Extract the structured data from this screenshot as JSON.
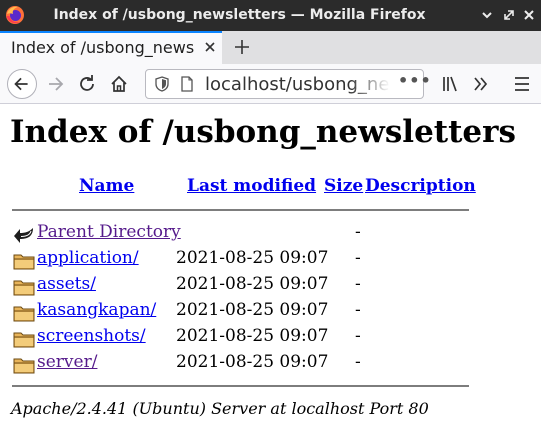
{
  "window": {
    "title": "Index of /usbong_newsletters — Mozilla Firefox"
  },
  "tab": {
    "title": "Index of /usbong_newsletters"
  },
  "address_bar": {
    "url": "localhost/usbong_newsletters/"
  },
  "page": {
    "heading": "Index of /usbong_newsletters",
    "columns": {
      "name": "Name",
      "last_modified": "Last modified",
      "size": "Size",
      "description": "Description"
    },
    "parent": {
      "label": "Parent Directory",
      "size": "-"
    },
    "entries": [
      {
        "name": "application/",
        "modified": "2021-08-25 09:07",
        "size": "-",
        "visited": false
      },
      {
        "name": "assets/",
        "modified": "2021-08-25 09:07",
        "size": "-",
        "visited": false
      },
      {
        "name": "kasangkapan/",
        "modified": "2021-08-25 09:07",
        "size": "-",
        "visited": false
      },
      {
        "name": "screenshots/",
        "modified": "2021-08-25 09:07",
        "size": "-",
        "visited": false
      },
      {
        "name": "server/",
        "modified": "2021-08-25 09:07",
        "size": "-",
        "visited": true
      }
    ],
    "footer": "Apache/2.4.41 (Ubuntu) Server at localhost Port 80"
  },
  "colors": {
    "link": "#0000ee",
    "visited_link": "#551a8b",
    "titlebar": "#2b2b2b",
    "tab_accent": "#0a84ff"
  },
  "icons": {
    "browser": "firefox-logo-icon",
    "parent": "back-arrow-icon",
    "folder": "folder-icon"
  }
}
